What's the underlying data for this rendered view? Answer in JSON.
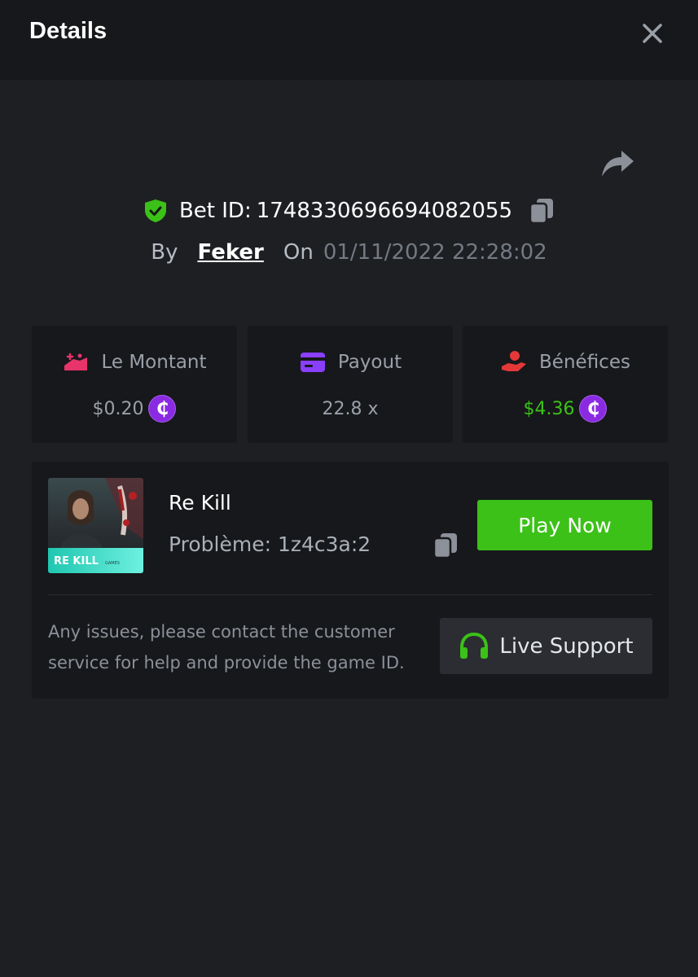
{
  "header": {
    "title": "Details"
  },
  "bet": {
    "label": "Bet ID:",
    "id": "1748330696694082055",
    "by_label": "By",
    "user": "Feker",
    "on_label": "On",
    "date": "01/11/2022 22:28:02"
  },
  "stats": [
    {
      "label": "Le Montant",
      "value": "$0.20",
      "icon": "amount-icon",
      "accent": "#e8336b"
    },
    {
      "label": "Payout",
      "value": "22.8 x",
      "icon": "card-icon",
      "accent": "#8a3ffc"
    },
    {
      "label": "Bénéfices",
      "value": "$4.36",
      "icon": "profit-icon",
      "accent": "#e43838"
    }
  ],
  "coin_symbol": "₵",
  "game": {
    "name": "Re Kill",
    "issue": "Problème: 1z4c3a:2",
    "play_label": "Play Now",
    "thumb_title": "RE KILL",
    "thumb_sub": "GAMES"
  },
  "support": {
    "help_text": "Any issues, please contact the customer service for help and provide the game ID.",
    "button_label": "Live Support"
  },
  "colors": {
    "background": "#1e1f23",
    "panel": "#17181b",
    "green": "#3bc117",
    "coin": "#8a2be2"
  }
}
